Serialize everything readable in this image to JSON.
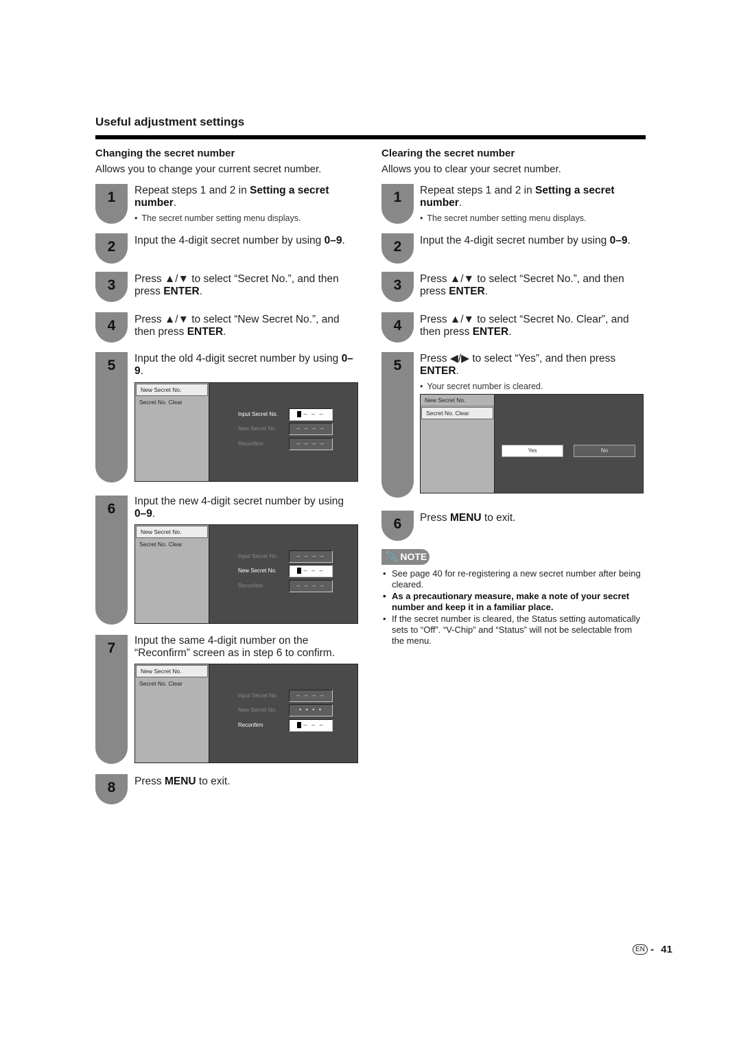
{
  "page": {
    "title": "Useful adjustment settings",
    "language_badge": "EN",
    "separator": "-",
    "page_number": "41"
  },
  "left": {
    "heading": "Changing the secret number",
    "description": "Allows you to change your current secret number.",
    "steps": [
      {
        "num": "1",
        "text": "Repeat steps 1 and 2 in ",
        "bold": "Setting a secret number",
        "tail": ".",
        "bullet": "The secret number setting menu displays."
      },
      {
        "num": "2",
        "text": "Input the 4-digit secret number by using ",
        "bold": "0–9",
        "tail": "."
      },
      {
        "num": "3",
        "text": "Press ▲/▼ to select “Secret No.”, and then press ",
        "bold": "ENTER",
        "tail": "."
      },
      {
        "num": "4",
        "text": "Press ▲/▼ to select “New Secret No.”, and then press ",
        "bold": "ENTER",
        "tail": "."
      },
      {
        "num": "5",
        "text": "Input the old 4-digit secret number by using ",
        "bold": "0–9",
        "tail": "."
      },
      {
        "num": "6",
        "text": "Input the new 4-digit secret number by using ",
        "bold": "0–9",
        "tail": "."
      },
      {
        "num": "7",
        "text": "Input the same 4-digit number on the “Reconfirm” screen as in step 6 to confirm.",
        "bold": "",
        "tail": ""
      },
      {
        "num": "8",
        "text": "Press ",
        "bold": "MENU",
        "tail": " to exit."
      }
    ]
  },
  "right": {
    "heading": "Clearing the secret number",
    "description": "Allows you to clear your secret number.",
    "steps": [
      {
        "num": "1",
        "text": "Repeat steps 1 and 2 in ",
        "bold": "Setting a secret number",
        "tail": ".",
        "bullet": "The secret number setting menu displays."
      },
      {
        "num": "2",
        "text": "Input the 4-digit secret number by using ",
        "bold": "0–9",
        "tail": "."
      },
      {
        "num": "3",
        "text": "Press ▲/▼ to select “Secret No.”, and then press ",
        "bold": "ENTER",
        "tail": "."
      },
      {
        "num": "4",
        "text": "Press ▲/▼ to select “Secret No. Clear”, and then press ",
        "bold": "ENTER",
        "tail": "."
      },
      {
        "num": "5",
        "text": "Press ◀/▶ to select “Yes”, and then press ",
        "bold": "ENTER",
        "tail": ".",
        "bullet": "Your secret number is cleared."
      },
      {
        "num": "6",
        "text": "Press ",
        "bold": "MENU",
        "tail": " to exit."
      }
    ]
  },
  "tv_menu": {
    "items": [
      "New Secret No.",
      "Secret No. Clear"
    ],
    "rows": [
      "Input Secret No.",
      "New Secret No.",
      "Reconfirm"
    ],
    "empty_value": "– – – –",
    "cursor_value": "– – –",
    "masked_value": "• • • •",
    "yes_label": "Yes",
    "no_label": "No"
  },
  "note": {
    "label": "NOTE",
    "items": [
      {
        "text": "See page 40 for re-registering a new secret number after being cleared.",
        "bold": false
      },
      {
        "text": "As a precautionary measure, make a note of your secret number and keep it in a familiar place.",
        "bold": true
      },
      {
        "text": "If the secret number is cleared, the Status setting automatically sets to “Off”. “V-Chip” and “Status” will not be selectable from the menu.",
        "bold": false
      }
    ]
  }
}
